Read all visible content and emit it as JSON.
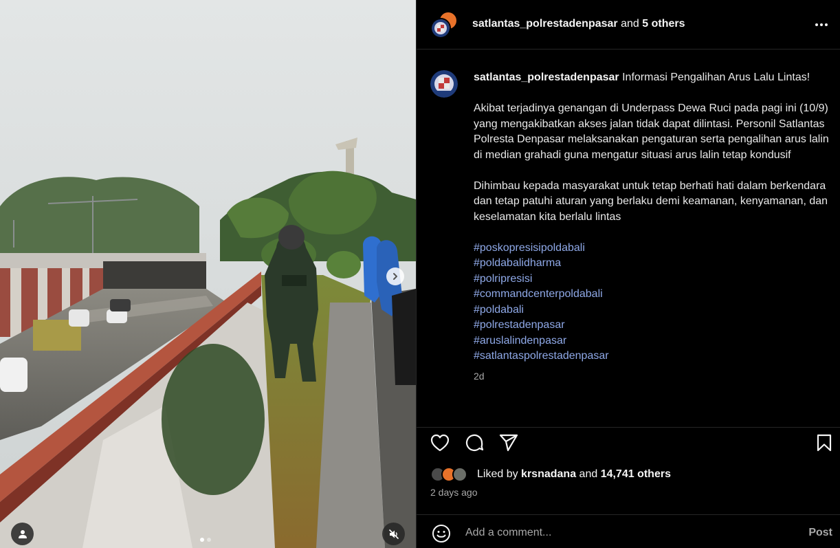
{
  "header": {
    "username": "satlantas_polrestadenpasar",
    "and_text": " and ",
    "others": "5 others",
    "more_icon": "more-horizontal-icon"
  },
  "caption": {
    "username": "satlantas_polrestadenpasar",
    "title": "Informasi Pengalihan Arus Lalu Lintas!",
    "paragraph1": "Akibat terjadinya genangan di Underpass Dewa Ruci pada pagi ini (10/9) yang mengakibatkan akses jalan tidak dapat dilintasi. Personil Satlantas Polresta Denpasar melaksanakan pengaturan serta pengalihan arus lalin di median grahadi guna mengatur situasi arus lalin tetap kondusif",
    "paragraph2": "Dihimbau kepada masyarakat untuk tetap berhati hati dalam berkendara dan tetap patuhi aturan yang berlaku demi keamanan, kenyamanan, dan keselamatan kita berlalu lintas",
    "hashtags": [
      "#poskopresisipoldabali",
      "#poldabalidharma",
      "#polripresisi",
      "#commandcenterpoldabali",
      "#poldabali",
      "#polrestadenpasar",
      "#aruslalindenpasar",
      "#satlantaspolrestadenpasar"
    ],
    "age": "2d"
  },
  "actions": {
    "like_icon": "heart-icon",
    "comment_icon": "comment-icon",
    "share_icon": "share-icon",
    "save_icon": "bookmark-icon"
  },
  "likes": {
    "prefix": "Liked by ",
    "user": "krsnadana",
    "and_text": " and ",
    "count": "14,741 others"
  },
  "post_date": "2 days ago",
  "comment": {
    "placeholder": "Add a comment...",
    "post_label": "Post",
    "emoji_icon": "emoji-icon"
  },
  "media": {
    "slide_count": 2,
    "active_slide": 1,
    "next_icon": "chevron-right-icon",
    "tag_icon": "user-tag-icon",
    "mute_icon": "muted-speaker-icon"
  },
  "colors": {
    "background": "#000000",
    "text": "#f5f5f5",
    "secondary_text": "#a8a8a8",
    "hashtag": "#8fa9e8",
    "divider": "#262626"
  }
}
